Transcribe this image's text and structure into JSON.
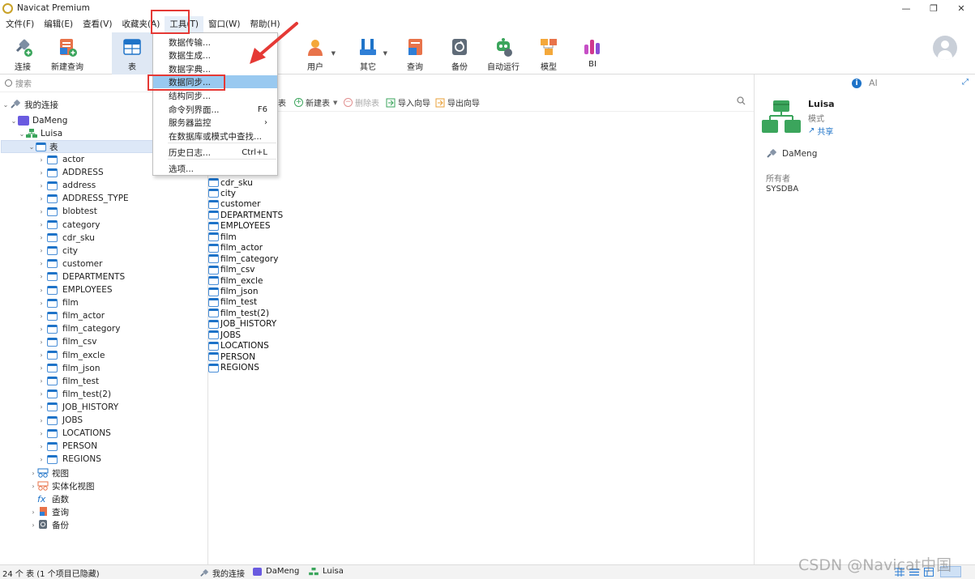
{
  "window": {
    "title": "Navicat Premium",
    "controls": [
      "✕",
      "❐",
      "—"
    ]
  },
  "menubar": [
    "文件(F)",
    "编辑(E)",
    "查看(V)",
    "收藏夹(A)",
    "工具(T)",
    "窗口(W)",
    "帮助(H)"
  ],
  "toolbar": {
    "connect": "连接",
    "new_query": "新建查询",
    "table": "表",
    "user": "用户",
    "other": "其它",
    "query": "查询",
    "backup": "备份",
    "automation": "自动运行",
    "model": "模型",
    "bi": "BI"
  },
  "tools_menu": {
    "items": [
      {
        "label": "数据传输...",
        "shortcut": ""
      },
      {
        "label": "数据生成...",
        "shortcut": ""
      },
      {
        "label": "数据字典...",
        "shortcut": ""
      },
      {
        "label": "数据同步...",
        "shortcut": ""
      },
      {
        "label": "结构同步...",
        "shortcut": ""
      },
      {
        "label": "命令列界面...",
        "shortcut": "F6"
      },
      {
        "label": "服务器监控",
        "shortcut": "›"
      },
      {
        "label": "在数据库或模式中查找...",
        "shortcut": ""
      },
      {
        "label": "历史日志...",
        "shortcut": "Ctrl+L"
      },
      {
        "label": "选项...",
        "shortcut": ""
      }
    ],
    "highlighted": "数据同步..."
  },
  "sidebar": {
    "search_placeholder": "搜索",
    "root": "我的连接",
    "connection": "DaMeng",
    "schema": "Luisa",
    "tables_node": "表",
    "tables": [
      "actor",
      "ADDRESS",
      "address",
      "ADDRESS_TYPE",
      "blobtest",
      "category",
      "cdr_sku",
      "city",
      "customer",
      "DEPARTMENTS",
      "EMPLOYEES",
      "film",
      "film_actor",
      "film_category",
      "film_csv",
      "film_excle",
      "film_json",
      "film_test",
      "film_test(2)",
      "JOB_HISTORY",
      "JOBS",
      "LOCATIONS",
      "PERSON",
      "REGIONS"
    ],
    "other_nodes": [
      "视图",
      "实体化视图",
      "函数",
      "查询",
      "备份"
    ]
  },
  "object_toolbar": {
    "partial": "表",
    "new_table": "新建表",
    "delete_table": "删除表",
    "import_wizard": "导入向导",
    "export_wizard": "导出向导"
  },
  "object_list": [
    "cdr_sku",
    "city",
    "customer",
    "DEPARTMENTS",
    "EMPLOYEES",
    "film",
    "film_actor",
    "film_category",
    "film_csv",
    "film_excle",
    "film_json",
    "film_test",
    "film_test(2)",
    "JOB_HISTORY",
    "JOBS",
    "LOCATIONS",
    "PERSON",
    "REGIONS"
  ],
  "info_panel": {
    "ai_label": "AI",
    "name": "Luisa",
    "type": "模式",
    "share": "共享",
    "connection": "DaMeng",
    "owner_label": "所有者",
    "owner": "SYSDBA"
  },
  "statusbar": {
    "count": "24 个 表 (1 个项目已隐藏)",
    "crumb_root": "我的连接",
    "crumb_conn": "DaMeng",
    "crumb_schema": "Luisa"
  },
  "watermark": "CSDN @Navicat中国"
}
